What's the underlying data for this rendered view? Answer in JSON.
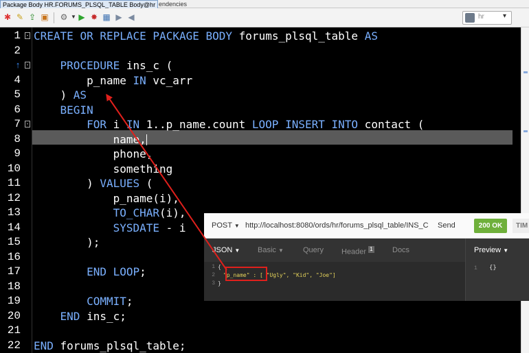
{
  "tabs": {
    "active": "Package Body HR.FORUMS_PLSQL_TABLE Body@hr",
    "inactive": "endencies"
  },
  "toolbar": {
    "icons": [
      "run-icon",
      "edit-icon",
      "compile-icon",
      "package-icon",
      "settings-icon",
      "play-icon",
      "debug-icon",
      "bookmark-icon",
      "forward-icon",
      "back-icon"
    ],
    "connection": "hr"
  },
  "editor": {
    "line_numbers": [
      "1",
      "2",
      "3",
      "4",
      "5",
      "6",
      "7",
      "8",
      "9",
      "10",
      "11",
      "12",
      "13",
      "14",
      "15",
      "16",
      "17",
      "18",
      "19",
      "20",
      "21",
      "22"
    ],
    "lines": [
      "CREATE OR REPLACE PACKAGE BODY forums_plsql_table AS",
      "",
      "    PROCEDURE ins_c (",
      "        p_name IN vc_arr",
      "    ) AS",
      "    BEGIN",
      "        FOR i IN 1..p_name.count LOOP INSERT INTO contact (",
      "            name,",
      "            phone,",
      "            something",
      "        ) VALUES (",
      "            p_name(i),",
      "            TO_CHAR(i),",
      "            SYSDATE - i",
      "        );",
      "",
      "        END LOOP;",
      "",
      "        COMMIT;",
      "    END ins_c;",
      "",
      "END forums_plsql_table;"
    ],
    "highlighted_line": 8
  },
  "rest_client": {
    "method": "POST",
    "url": "http://localhost:8080/ords/hr/forums_plsql_table/INS_C",
    "send_label": "Send",
    "status": "200 OK",
    "time_label": "TIM",
    "tabs": [
      "JSON",
      "Basic",
      "Query",
      "Header",
      "Docs"
    ],
    "header_count": "1",
    "body_lines": [
      "{",
      "\"p_name\" : [ \"Ugly\", \"Kid\", \"Joe\"]",
      "}"
    ],
    "body_line_numbers": [
      "1",
      "2",
      "3"
    ],
    "preview_label": "Preview",
    "preview_line": "1",
    "preview_value": "{}"
  },
  "colors": {
    "editor_bg": "#000000",
    "keyword": "#7ab0ff",
    "highlight": "#5a5a5a",
    "annotation": "#e0201c",
    "status_ok": "#6fb03b"
  }
}
